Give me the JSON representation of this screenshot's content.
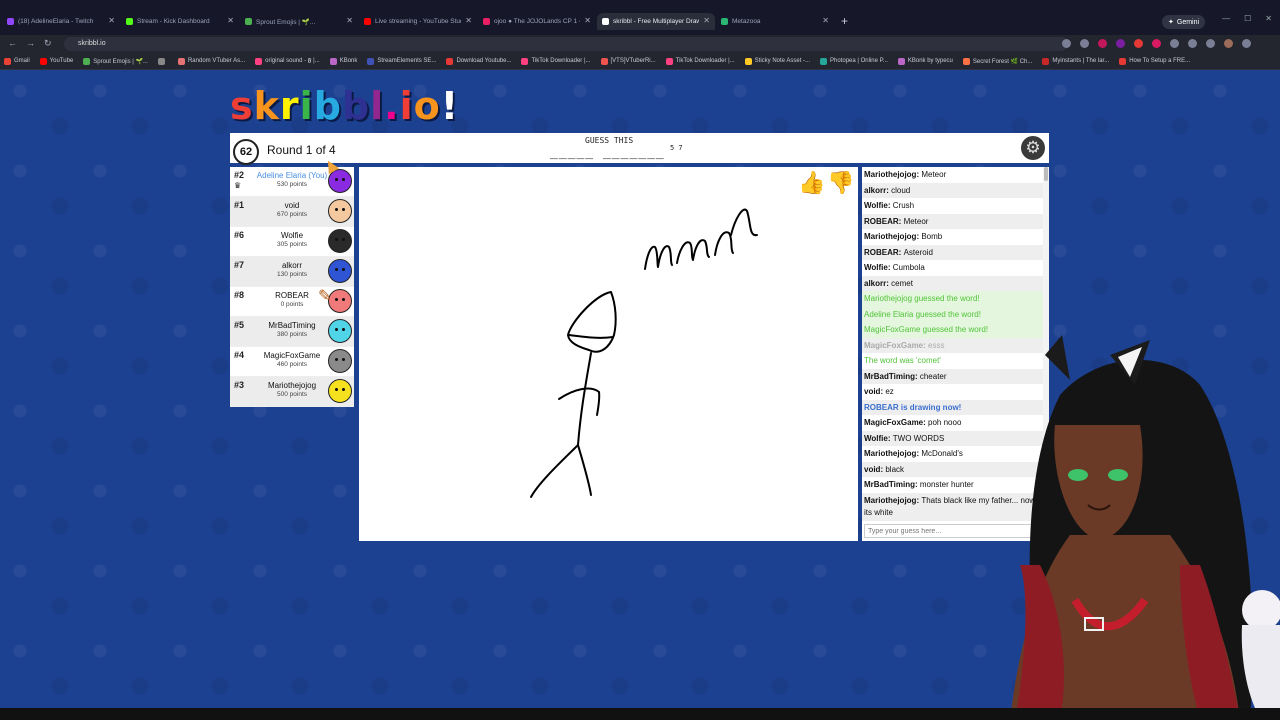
{
  "browser": {
    "tabs": [
      {
        "label": "(18) AdelineElaria - Twitch",
        "color": "#9147ff",
        "active": false
      },
      {
        "label": "Stream - Kick Dashboard",
        "color": "#53fc18",
        "active": false
      },
      {
        "label": "Sprout Emojis | 🌱...",
        "color": "#4caf50",
        "active": false
      },
      {
        "label": "Live streaming - YouTube Studio",
        "color": "#ff0000",
        "active": false
      },
      {
        "label": "ojoo ● The JOJOLands CP 1 ●",
        "color": "#e91e63",
        "active": false
      },
      {
        "label": "skribbl - Free Multiplayer Draw",
        "color": "#ffffff",
        "active": true
      },
      {
        "label": "Metazooa",
        "color": "#2bb673",
        "active": false
      }
    ],
    "new_tab_icon": "+",
    "gemini_label": "Gemini",
    "url": "skribbl.io",
    "bookmarks": [
      {
        "label": "Gmail",
        "color": "#ea4335"
      },
      {
        "label": "YouTube",
        "color": "#ff0000"
      },
      {
        "label": "Sprout Emojis | 🌱...",
        "color": "#4caf50"
      },
      {
        "label": "",
        "color": "#888888"
      },
      {
        "label": "Random VTuber As...",
        "color": "#e57373"
      },
      {
        "label": "original sound - 𝕱 |...",
        "color": "#ff4081"
      },
      {
        "label": "KBonk",
        "color": "#ba68c8"
      },
      {
        "label": "StreamElements SE...",
        "color": "#3f51b5"
      },
      {
        "label": "Download Youtube...",
        "color": "#e53935"
      },
      {
        "label": "TikTok Downloader |...",
        "color": "#ff4081"
      },
      {
        "label": "[VTS]VTuberRi...",
        "color": "#ef5350"
      },
      {
        "label": "TikTok Downloader |...",
        "color": "#ff4081"
      },
      {
        "label": "Sticky Note Asset -...",
        "color": "#ffca28"
      },
      {
        "label": "Photopea | Online P...",
        "color": "#26a69a"
      },
      {
        "label": "KBonk by typecu",
        "color": "#ba68c8"
      },
      {
        "label": "Secret Forest 🌿 Ch...",
        "color": "#ff7043"
      },
      {
        "label": "Myinstants | The lar...",
        "color": "#c62828"
      },
      {
        "label": "How To Setup a FRE...",
        "color": "#e53935"
      }
    ]
  },
  "game": {
    "logo_letters": [
      {
        "ch": "s",
        "color": "#ef3e36"
      },
      {
        "ch": "k",
        "color": "#f7941d"
      },
      {
        "ch": "r",
        "color": "#fff200"
      },
      {
        "ch": "i",
        "color": "#39b54a"
      },
      {
        "ch": "b",
        "color": "#27aae1"
      },
      {
        "ch": "b",
        "color": "#2e3192"
      },
      {
        "ch": "l",
        "color": "#92278f"
      },
      {
        "ch": ".",
        "color": "#ec008c"
      },
      {
        "ch": "i",
        "color": "#ef3e36"
      },
      {
        "ch": "o",
        "color": "#f7941d"
      },
      {
        "ch": "!",
        "color": "#ffffff"
      }
    ],
    "timer": "62",
    "round": "Round 1 of 4",
    "guess_label": "GUESS THIS",
    "word_blanks": "_____ _______",
    "word_lengths": "5 7",
    "players": [
      {
        "rank": "#2",
        "name": "Adeline Elaria (You)",
        "points": "530 points",
        "avatar_color": "#8a2be2",
        "me": true,
        "crown": true
      },
      {
        "rank": "#1",
        "name": "void",
        "points": "670 points",
        "avatar_color": "#f4c9a0",
        "me": false,
        "crown": false
      },
      {
        "rank": "#6",
        "name": "Wolfie",
        "points": "305 points",
        "avatar_color": "#2a2a2a",
        "me": false,
        "crown": false
      },
      {
        "rank": "#7",
        "name": "alkorr",
        "points": "130 points",
        "avatar_color": "#2f55d4",
        "me": false,
        "crown": false
      },
      {
        "rank": "#8",
        "name": "ROBEAR",
        "points": "0 points",
        "avatar_color": "#f07a7a",
        "me": false,
        "crown": false
      },
      {
        "rank": "#5",
        "name": "MrBadTiming",
        "points": "380 points",
        "avatar_color": "#4fd4e8",
        "me": false,
        "crown": false
      },
      {
        "rank": "#4",
        "name": "MagicFoxGame",
        "points": "460 points",
        "avatar_color": "#8a8a8a",
        "me": false,
        "crown": false
      },
      {
        "rank": "#3",
        "name": "Mariothejojog",
        "points": "500 points",
        "avatar_color": "#f5e11d",
        "me": false,
        "crown": false
      }
    ],
    "chat": [
      {
        "user": "Mariothejojog",
        "text": "Meteor",
        "type": "normal"
      },
      {
        "user": "alkorr",
        "text": "cloud",
        "type": "normal"
      },
      {
        "user": "Wolfie",
        "text": "Crush",
        "type": "normal"
      },
      {
        "user": "ROBEAR",
        "text": "Meteor",
        "type": "normal"
      },
      {
        "user": "Mariothejojog",
        "text": "Bomb",
        "type": "normal"
      },
      {
        "user": "ROBEAR",
        "text": "Asteroid",
        "type": "normal"
      },
      {
        "user": "Wolfie",
        "text": "Cumbola",
        "type": "normal"
      },
      {
        "user": "alkorr",
        "text": "cemet",
        "type": "normal"
      },
      {
        "user": "",
        "text": "Mariothejojog guessed the word!",
        "type": "guessed"
      },
      {
        "user": "",
        "text": "Adeline Elaria guessed the word!",
        "type": "guessed"
      },
      {
        "user": "",
        "text": "MagicFoxGame guessed the word!",
        "type": "guessed"
      },
      {
        "user": "MagicFoxGame",
        "text": "esss",
        "type": "close"
      },
      {
        "user": "",
        "text": "The word was 'comet'",
        "type": "sys-green"
      },
      {
        "user": "MrBadTiming",
        "text": "cheater",
        "type": "normal"
      },
      {
        "user": "void",
        "text": "ez",
        "type": "normal"
      },
      {
        "user": "",
        "text": "ROBEAR is drawing now!",
        "type": "sys-blue"
      },
      {
        "user": "MagicFoxGame",
        "text": "poh nooo",
        "type": "normal"
      },
      {
        "user": "Wolfie",
        "text": "TWO WORDS",
        "type": "normal"
      },
      {
        "user": "Mariothejojog",
        "text": "McDonald's",
        "type": "normal"
      },
      {
        "user": "void",
        "text": "black",
        "type": "normal"
      },
      {
        "user": "MrBadTiming",
        "text": "monster hunter",
        "type": "normal"
      },
      {
        "user": "Mariothejojog",
        "text": "Thats black like my father... now its white",
        "type": "multi"
      }
    ],
    "chat_placeholder": "Type your guess here...",
    "canvas_text": "mmn"
  }
}
